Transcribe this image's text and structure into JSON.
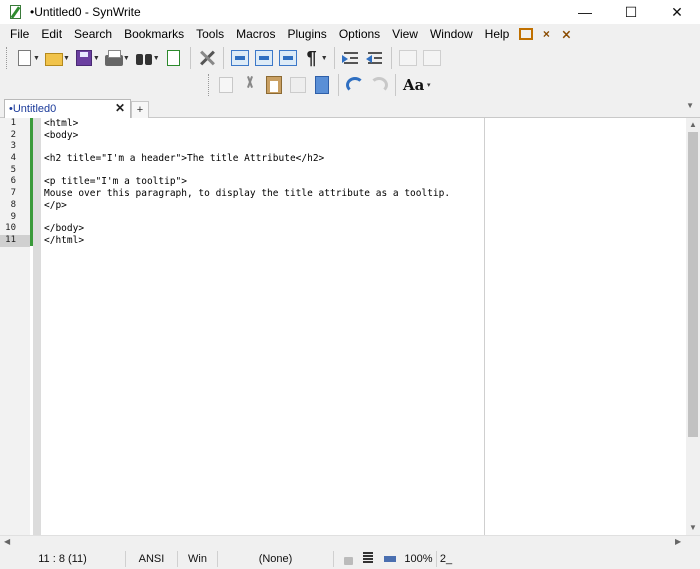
{
  "window": {
    "title": "•Untitled0 - SynWrite",
    "minimize_glyph": "—",
    "maximize_glyph": "☐",
    "close_glyph": "✕"
  },
  "menu": {
    "items": [
      "File",
      "Edit",
      "Search",
      "Bookmarks",
      "Tools",
      "Macros",
      "Plugins",
      "Options",
      "View",
      "Window",
      "Help"
    ],
    "extra_close_glyph": "×",
    "extra_pin_glyph": "⨯"
  },
  "toolbar1": {
    "icons": [
      "new-file-icon",
      "open-folder-icon",
      "save-icon",
      "print-icon",
      "find-binoculars-icon",
      "preview-icon",
      "tools-icon",
      "jump-back-icon",
      "jump-down-icon",
      "jump-forward-icon",
      "pilcrow-icon",
      "indent-icon",
      "unindent-icon",
      "block-left-icon",
      "block-right-icon"
    ],
    "pilcrow": "¶",
    "dropdown_glyph": "▼"
  },
  "toolbar2": {
    "icons": [
      "copy-icon",
      "cut-icon",
      "paste-icon",
      "delete-icon",
      "clipboard-icon",
      "undo-icon",
      "redo-icon",
      "font-icon"
    ],
    "font_label": "Aa",
    "dropdown_glyph": "▾"
  },
  "tabs": {
    "items": [
      {
        "label": "•Untitled0",
        "active": true
      }
    ],
    "close_glyph": "✕",
    "add_glyph": "+",
    "scroll_glyph": "▼"
  },
  "editor": {
    "current_line": 11,
    "lines": [
      "<html>",
      "<body>",
      "",
      "<h2 title=\"I'm a header\">The title Attribute</h2>",
      "",
      "<p title=\"I'm a tooltip\">",
      "Mouse over this paragraph, to display the title attribute as a tooltip.",
      "</p>",
      "",
      "</body>",
      "</html>"
    ],
    "line_numbers": [
      "1",
      "2",
      "3",
      "4",
      "5",
      "6",
      "7",
      "8",
      "9",
      "10",
      "11"
    ],
    "scroll_up_glyph": "▲",
    "scroll_down_glyph": "▼",
    "scroll_left_glyph": "◀",
    "scroll_right_glyph": "▶"
  },
  "status": {
    "position": "11 : 8 (11)",
    "encoding": "ANSI",
    "line_ending": "Win",
    "lexer": "(None)",
    "zoom": "100%",
    "extra": "2_"
  },
  "colors": {
    "accent": "#2f6fc1",
    "change_bar": "#3a9a3a",
    "tab_text": "#1a3a9a"
  }
}
